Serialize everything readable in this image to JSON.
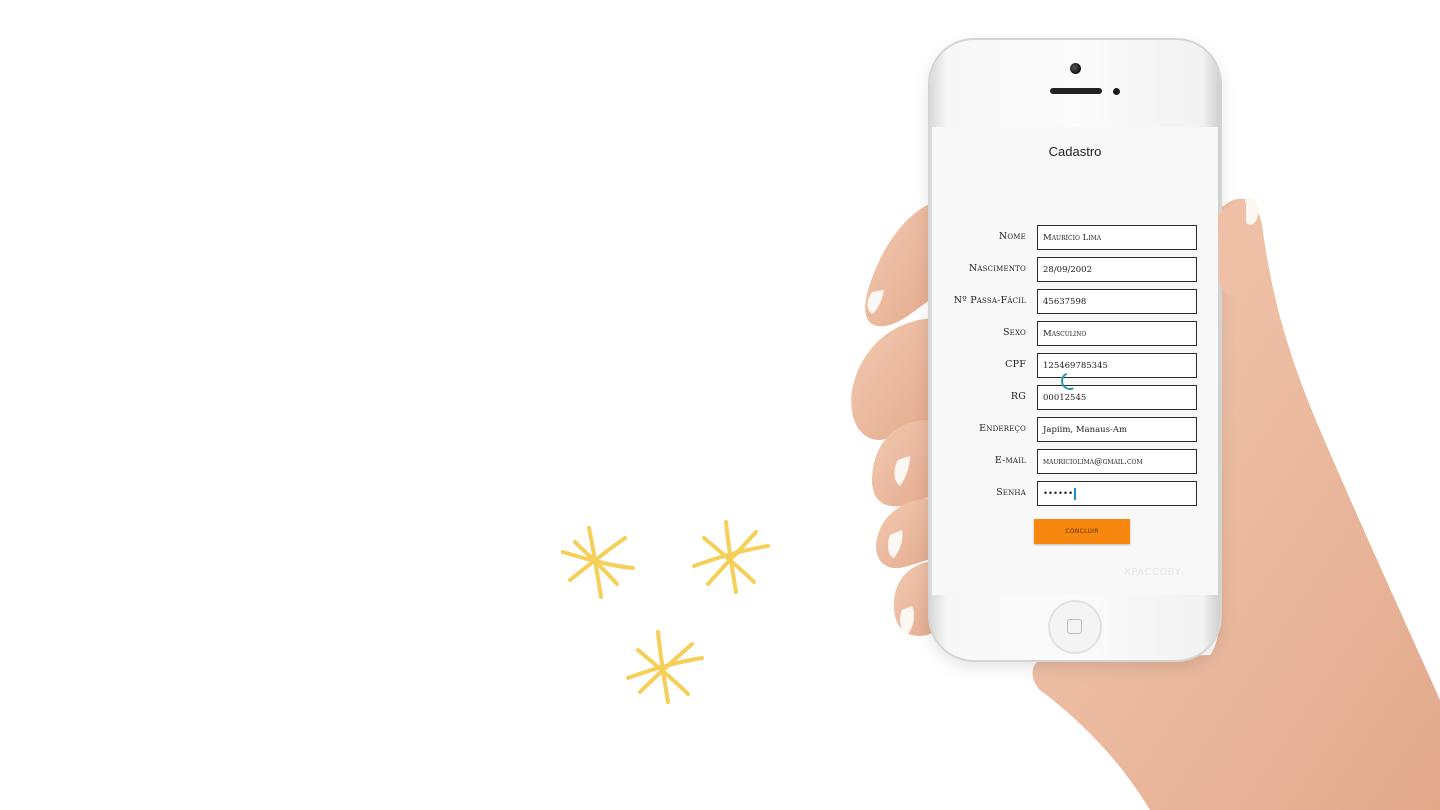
{
  "screen": {
    "title": "Cadastro",
    "watermark": "XPACCOBY"
  },
  "form": {
    "fields": [
      {
        "label": "Nome",
        "value": "Maurício Lima"
      },
      {
        "label": "Nascimento",
        "value": "28/09/2002"
      },
      {
        "label": "Nº Passa-Fácil",
        "value": "45637598"
      },
      {
        "label": "Sexo",
        "value": "Masculino"
      },
      {
        "label": "CPF",
        "value": "12546978534​5"
      },
      {
        "label": "RG",
        "value": "00012545"
      },
      {
        "label": "Endereço",
        "value": "Japiim, Manaus-Am"
      },
      {
        "label": "E-mail",
        "value": "mauriciolima@gmail.com"
      },
      {
        "label": "Senha",
        "value": "••••••"
      }
    ],
    "submit_label": "CONCLUIR"
  },
  "colors": {
    "accent": "#f7870f",
    "spinner": "#2a9aa6",
    "sparkle": "#f6cf58",
    "skin": "#f0c3a8"
  },
  "icons": {
    "spinner": "loading-spinner-icon",
    "sparkle": "sparkle-icon",
    "home": "home-button-icon"
  }
}
